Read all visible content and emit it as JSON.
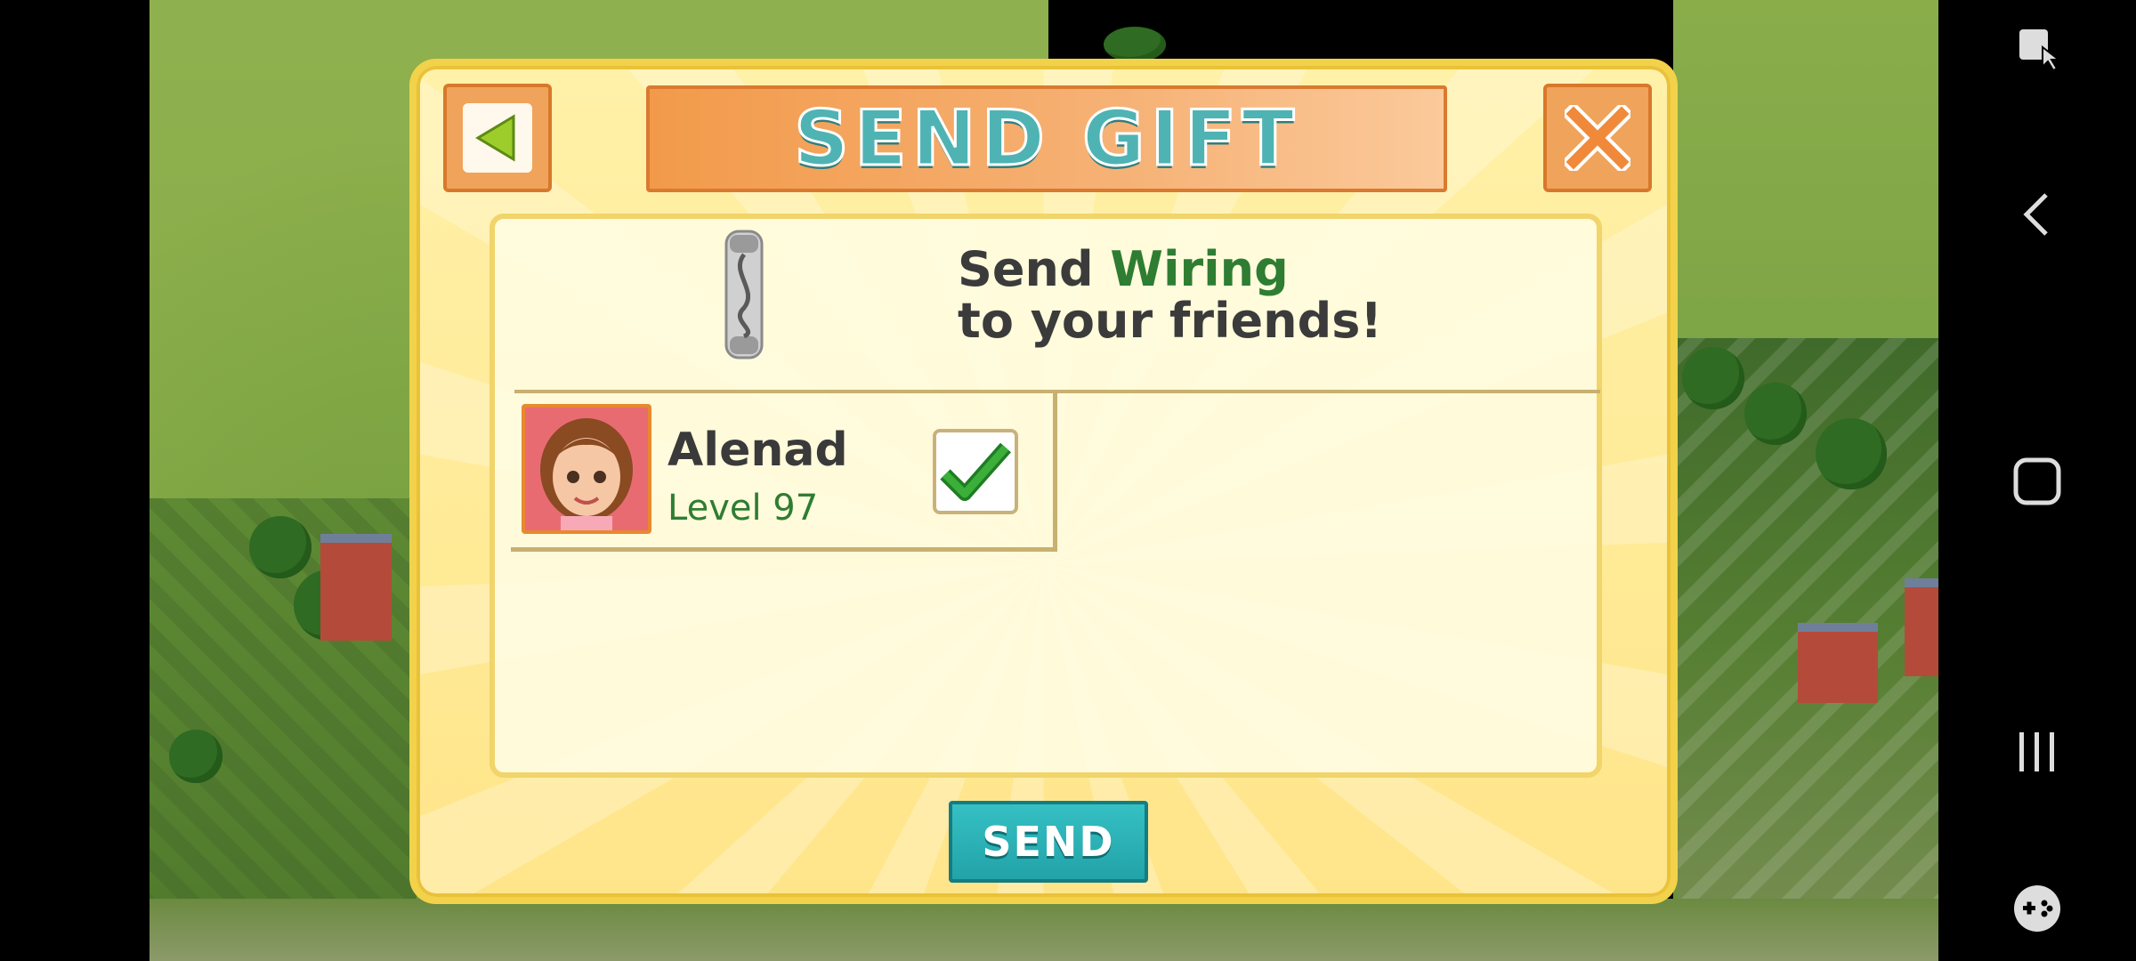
{
  "dialog": {
    "title": "SEND GIFT",
    "headline_prefix": "Send ",
    "item_name": "Wiring",
    "headline_suffix": "to your friends!",
    "send_label": "SEND"
  },
  "friends": [
    {
      "name": "Alenad",
      "level": "Level 97",
      "selected": true
    }
  ],
  "icons": {
    "back": "left-arrow-icon",
    "close": "close-x-icon",
    "item": "wiring-icon",
    "checkbox": "checkmark-icon"
  },
  "colors": {
    "title_text": "#4fb3b3",
    "item_highlight": "#2e7d32",
    "send_button": "#22a3a8",
    "dialog_border": "#f2d24a"
  }
}
